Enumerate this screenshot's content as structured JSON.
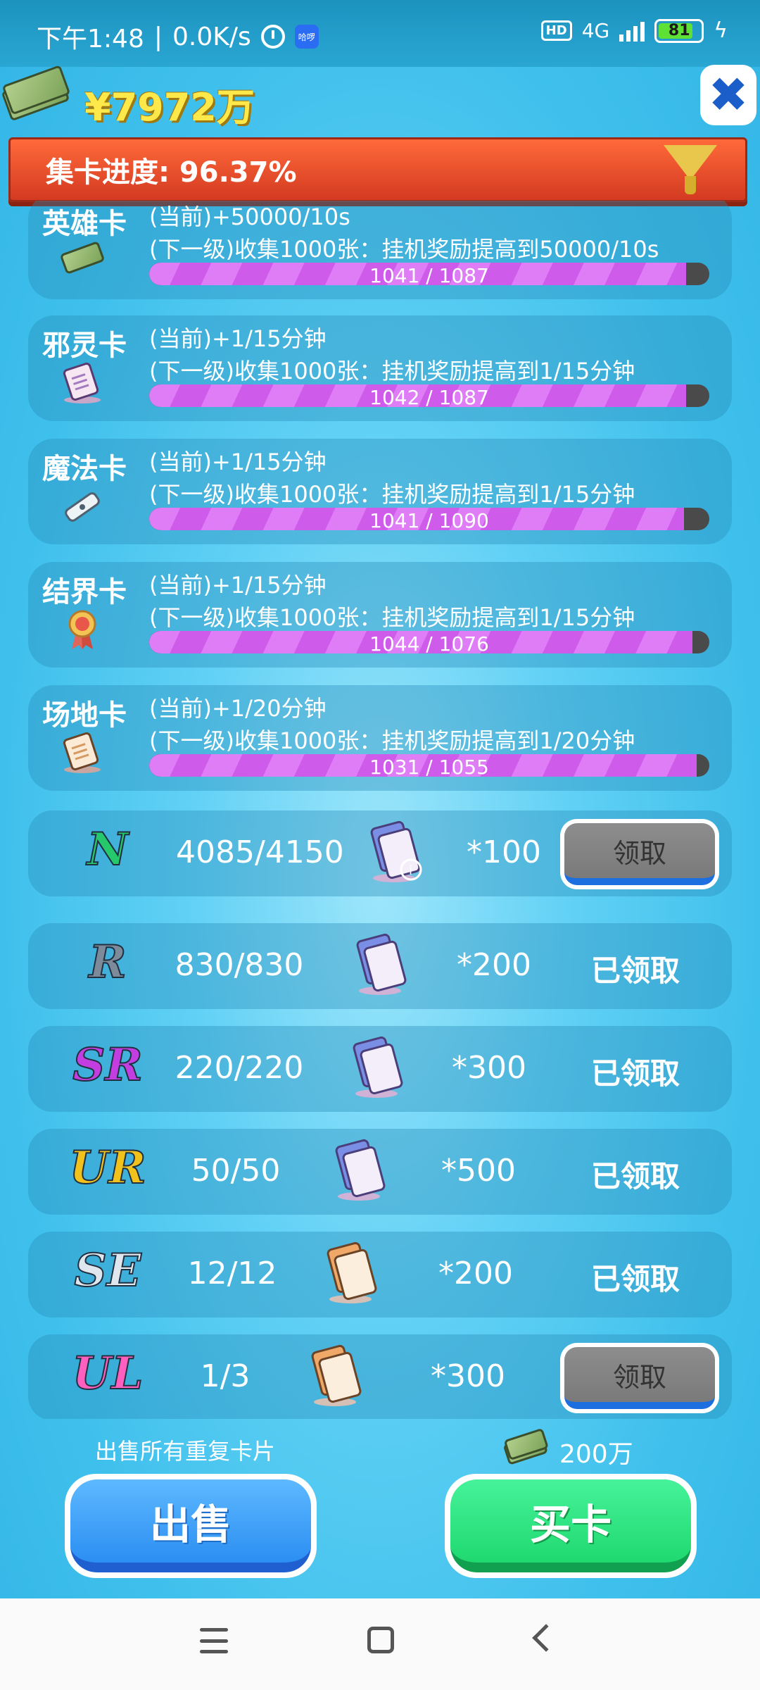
{
  "status": {
    "time": "下午1:48",
    "speed": "0.0K/s",
    "app_badge": "哈啰",
    "hd": "HD",
    "network": "4G",
    "battery": "81"
  },
  "header": {
    "money": "¥7972万",
    "close_icon": "✖",
    "progress_label": "集卡进度: 96.37%"
  },
  "cards": [
    {
      "name": "英雄卡",
      "current": "(当前)+50000/10s",
      "next": "(下一级)收集1000张：挂机奖励提高到50000/10s",
      "progress_text": "1041 / 1087",
      "progress": 0.958,
      "icon": "money-icon"
    },
    {
      "name": "邪灵卡",
      "current": "(当前)+1/15分钟",
      "next": "(下一级)收集1000张：挂机奖励提高到1/15分钟",
      "progress_text": "1042 / 1087",
      "progress": 0.959,
      "icon": "ticket-icon"
    },
    {
      "name": "魔法卡",
      "current": "(当前)+1/15分钟",
      "next": "(下一级)收集1000张：挂机奖励提高到1/15分钟",
      "progress_text": "1041 / 1090",
      "progress": 0.955,
      "icon": "scroll-icon"
    },
    {
      "name": "结界卡",
      "current": "(当前)+1/15分钟",
      "next": "(下一级)收集1000张：挂机奖励提高到1/15分钟",
      "progress_text": "1044 / 1076",
      "progress": 0.97,
      "icon": "medal-icon"
    },
    {
      "name": "场地卡",
      "current": "(当前)+1/20分钟",
      "next": "(下一级)收集1000张：挂机奖励提高到1/20分钟",
      "progress_text": "1031 / 1055",
      "progress": 0.977,
      "icon": "ticket-icon"
    }
  ],
  "rewards": [
    {
      "rarity": "N",
      "count": "4085/4150",
      "amount": "*100",
      "state": "领取",
      "claimable": true,
      "color": "#25c86a"
    },
    {
      "rarity": "R",
      "count": "830/830",
      "amount": "*200",
      "state": "已领取",
      "claimable": false,
      "color": "#7d8a99"
    },
    {
      "rarity": "SR",
      "count": "220/220",
      "amount": "*300",
      "state": "已领取",
      "claimable": false,
      "color": "#c23ee0"
    },
    {
      "rarity": "UR",
      "count": "50/50",
      "amount": "*500",
      "state": "已领取",
      "claimable": false,
      "color": "#f2c21c"
    },
    {
      "rarity": "SE",
      "count": "12/12",
      "amount": "*200",
      "state": "已领取",
      "claimable": false,
      "color": "#dfe6ee"
    },
    {
      "rarity": "UL",
      "count": "1/3",
      "amount": "*300",
      "state": "领取",
      "claimable": true,
      "color": "#ff5fbf"
    }
  ],
  "bottom": {
    "sell_caption": "出售所有重复卡片",
    "price": "200万",
    "sell_label": "出售",
    "buy_label": "买卡"
  }
}
